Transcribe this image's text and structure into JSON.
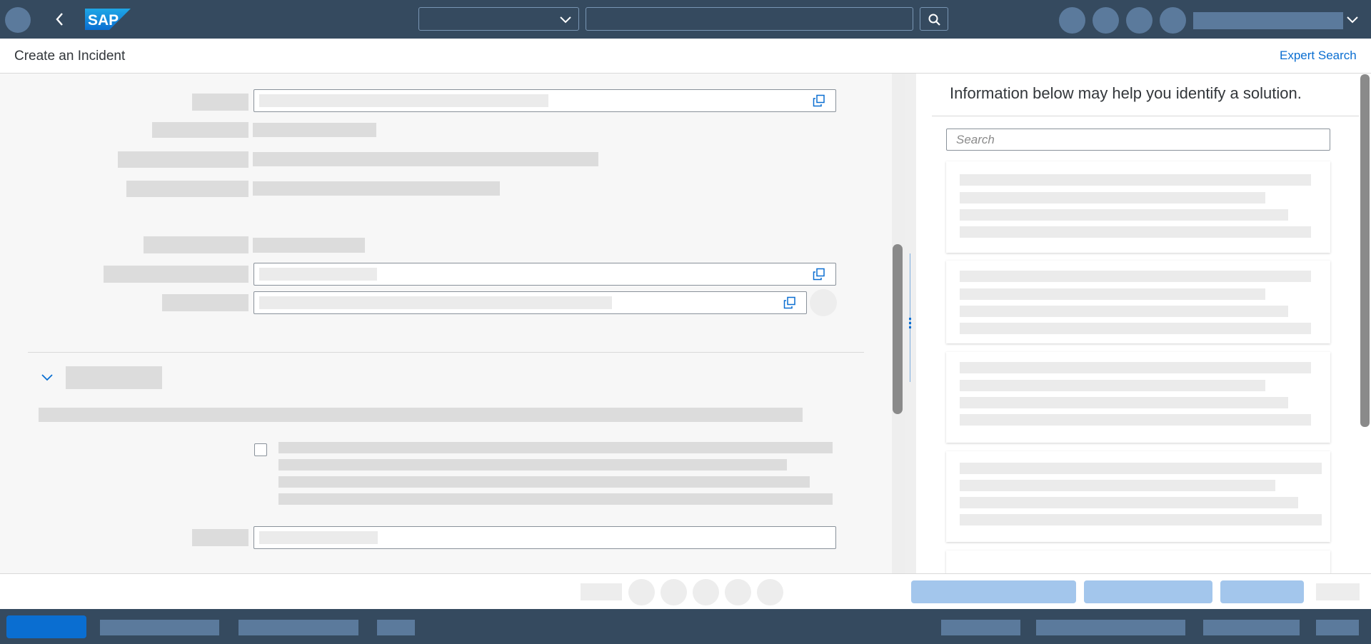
{
  "page": {
    "title": "Create an Incident",
    "expert_search_label": "Expert Search"
  },
  "shell": {
    "logo_text": "SAP"
  },
  "solution_panel": {
    "heading": "Information below may help you identify a solution.",
    "search_placeholder": "Search"
  },
  "colors": {
    "shell_bg": "#354a5f",
    "link": "#0a6ed1",
    "placeholder": "#dcdcdc",
    "emphasized_button": "#a3c6ec"
  }
}
